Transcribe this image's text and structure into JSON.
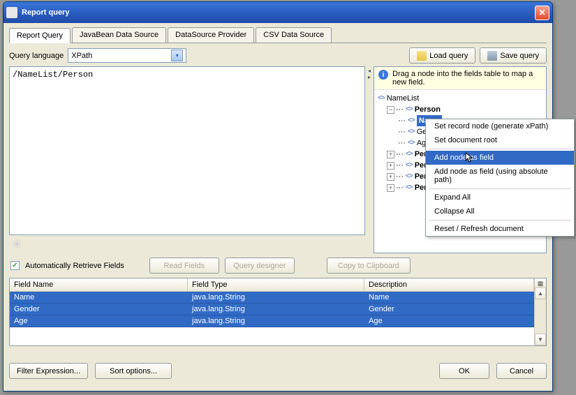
{
  "window": {
    "title": "Report query"
  },
  "tabs": [
    {
      "label": "Report Query"
    },
    {
      "label": "JavaBean Data Source"
    },
    {
      "label": "DataSource Provider"
    },
    {
      "label": "CSV Data Source"
    }
  ],
  "query": {
    "language_label": "Query language",
    "language_value": "XPath",
    "text": "/NameList/Person",
    "load_btn": "Load query",
    "save_btn": "Save query"
  },
  "hint": "Drag a node into the fields table to map a new field.",
  "tree": {
    "root": "NameList",
    "person": "Person",
    "children": [
      "Name",
      "Ge",
      "Ag"
    ],
    "siblings": [
      "Perso",
      "Perso",
      "Perso",
      "Perso"
    ]
  },
  "context_menu": {
    "items": [
      "Set record node (generate xPath)",
      "Set document root",
      "Add node as field",
      "Add node as field (using absolute path)",
      "Expand All",
      "Collapse All",
      "Reset / Refresh document"
    ]
  },
  "options": {
    "auto_retrieve": "Automatically Retrieve Fields",
    "read_fields": "Read Fields",
    "query_designer": "Query designer",
    "copy_clipboard": "Copy to Clipboard"
  },
  "table": {
    "headers": [
      "Field Name",
      "Field Type",
      "Description"
    ],
    "rows": [
      {
        "name": "Name",
        "type": "java.lang.String",
        "desc": "Name"
      },
      {
        "name": "Gender",
        "type": "java.lang.String",
        "desc": "Gender"
      },
      {
        "name": "Age",
        "type": "java.lang.String",
        "desc": "Age"
      }
    ]
  },
  "footer": {
    "filter": "Filter Expression...",
    "sort": "Sort options...",
    "ok": "OK",
    "cancel": "Cancel"
  }
}
